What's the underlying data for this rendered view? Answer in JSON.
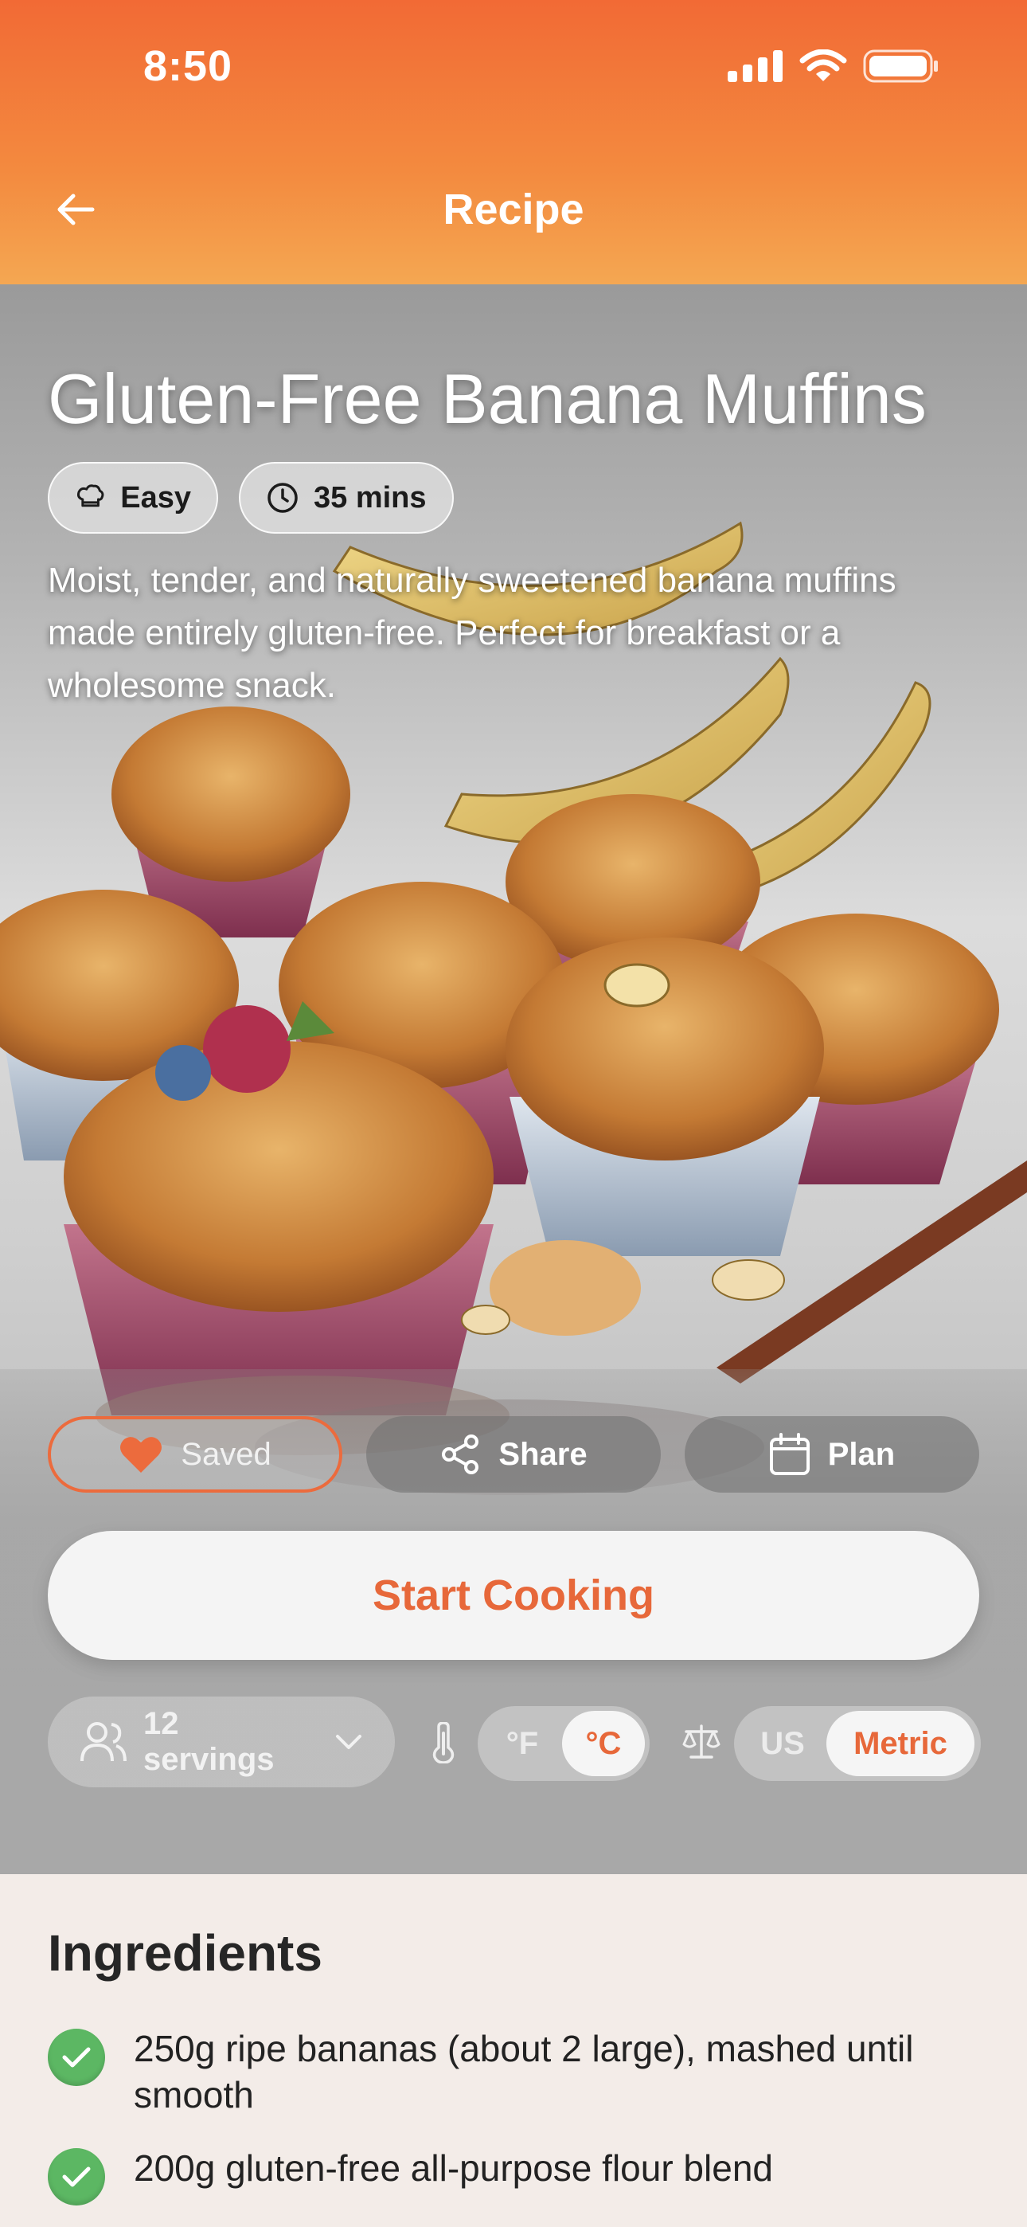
{
  "status": {
    "time": "8:50"
  },
  "nav": {
    "title": "Recipe"
  },
  "recipe": {
    "title": "Gluten-Free Banana Muffins",
    "difficulty": "Easy",
    "time": "35 mins",
    "description": "Moist, tender, and naturally sweetened banana muffins made entirely gluten-free. Perfect for breakfast or a wholesome snack."
  },
  "actions": {
    "saved": "Saved",
    "share": "Share",
    "plan": "Plan"
  },
  "start_cooking": "Start Cooking",
  "controls": {
    "servings": "12 servings",
    "temp_f": "°F",
    "temp_c": "°C",
    "temp_selected": "°C",
    "unit_us": "US",
    "unit_metric": "Metric",
    "unit_selected": "Metric"
  },
  "ingredients": {
    "heading": "Ingredients",
    "items": [
      {
        "text": "250g ripe bananas (about 2 large), mashed until smooth",
        "checked": true
      },
      {
        "text": "200g gluten-free all-purpose flour blend",
        "checked": true
      }
    ]
  },
  "colors": {
    "accent": "#e7683a",
    "header_top": "#f26a35",
    "header_bottom": "#f4a752",
    "check": "#5cb763"
  },
  "icons": [
    "signal-icon",
    "wifi-icon",
    "battery-icon",
    "back-arrow-icon",
    "chef-hat-icon",
    "clock-icon",
    "heart-icon",
    "share-icon",
    "calendar-icon",
    "people-icon",
    "chevron-down-icon",
    "thermometer-icon",
    "scale-icon",
    "checkmark-icon"
  ]
}
